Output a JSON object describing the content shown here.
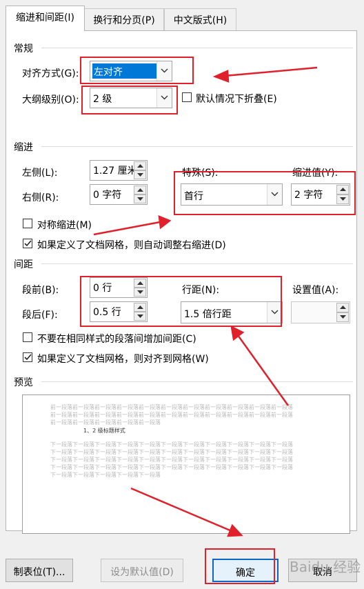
{
  "tabs": [
    {
      "label": "缩进和间距(I)",
      "active": true
    },
    {
      "label": "换行和分页(P)",
      "active": false
    },
    {
      "label": "中文版式(H)",
      "active": false
    }
  ],
  "general": {
    "title": "常规",
    "alignment_label": "对齐方式(G):",
    "alignment_value": "左对齐",
    "outline_label": "大纲级别(O):",
    "outline_value": "2 级",
    "collapse_label": "默认情况下折叠(E)",
    "collapse_checked": false
  },
  "indent": {
    "title": "缩进",
    "left_label": "左侧(L):",
    "left_value": "1.27 厘米",
    "right_label": "右侧(R):",
    "right_value": "0 字符",
    "special_label": "特殊(S):",
    "special_value": "首行",
    "by_label": "缩进值(Y):",
    "by_value": "2 字符",
    "mirror_label": "对称缩进(M)",
    "mirror_checked": false,
    "auto_adjust_label": "如果定义了文档网格，则自动调整右缩进(D)",
    "auto_adjust_checked": true
  },
  "spacing": {
    "title": "间距",
    "before_label": "段前(B):",
    "before_value": "0 行",
    "after_label": "段后(F):",
    "after_value": "0.5 行",
    "line_label": "行距(N):",
    "line_value": "1.5 倍行距",
    "at_label": "设置值(A):",
    "at_value": "",
    "no_space_label": "不要在相同样式的段落间增加间距(C)",
    "no_space_checked": false,
    "snap_grid_label": "如果定义了文档网格，则对齐到网格(W)",
    "snap_grid_checked": true
  },
  "preview": {
    "title": "预览",
    "prev_lines": [
      "前一段落前一段落前一段落前一段落前一段落前一段落前一段落前一段落前一段落前一段落前一段落",
      "前一段落前一段落前一段落前一段落前一段落前一段落前一段落前一段落前一段落前一段落前一段落",
      "前一段落前一段落前一段落前一段落前一段落"
    ],
    "heading": "1、2 级标题样式",
    "next_lines": [
      "下一段落下一段落下一段落下一段落下一段落下一段落下一段落下一段落下一段落下一段落下一段落",
      "下一段落下一段落下一段落下一段落下一段落下一段落下一段落下一段落下一段落下一段落下一段落",
      "下一段落下一段落下一段落下一段落下一段落下一段落下一段落下一段落下一段落下一段落下一段落",
      "下一段落下一段落下一段落下一段落下一段落下一段落下一段落下一段落下一段落下一段落下一段落",
      "下一段落下一段落下一段落下一段落下一段落"
    ]
  },
  "buttons": {
    "tabs_label": "制表位(T)...",
    "default_label": "设为默认值(D)",
    "ok_label": "确定",
    "cancel_label": "取消"
  },
  "colors": {
    "annotation": "#e0202a",
    "selection": "#0078d7",
    "ok_border": "#0a67c7"
  }
}
